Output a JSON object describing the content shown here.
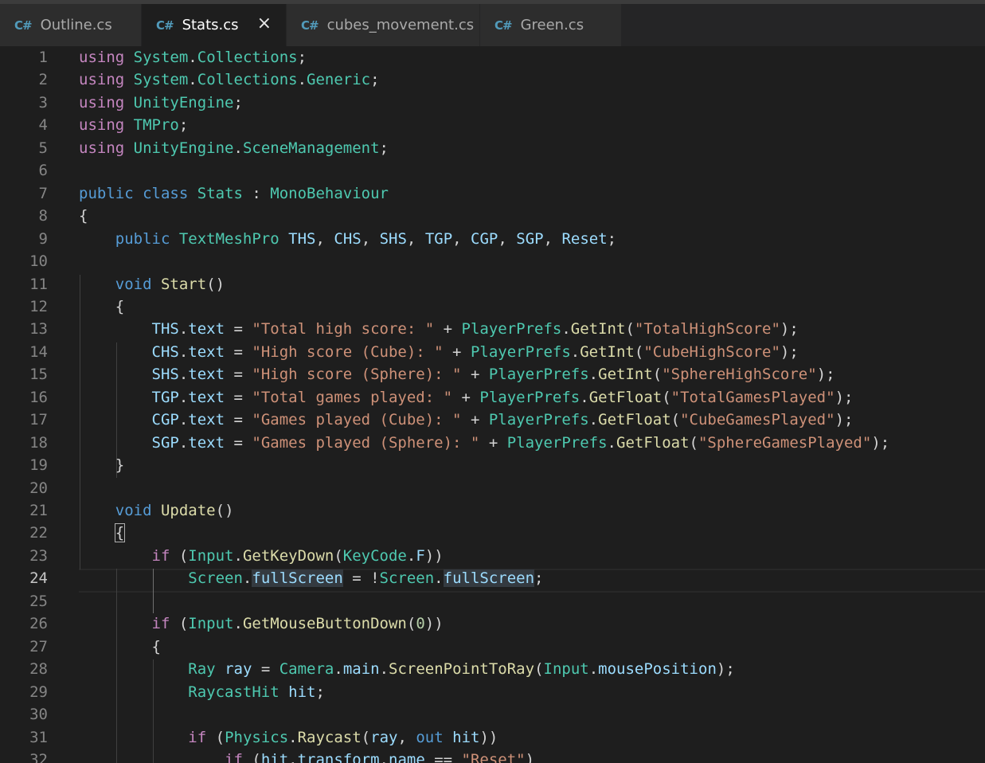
{
  "tabs": [
    {
      "icon": "C#",
      "label": "Outline.cs",
      "active": false
    },
    {
      "icon": "C#",
      "label": "Stats.cs",
      "active": true,
      "close": "×"
    },
    {
      "icon": "C#",
      "label": "cubes_movement.cs",
      "active": false
    },
    {
      "icon": "C#",
      "label": "Green.cs",
      "active": false
    }
  ],
  "editor": {
    "current_line": 24,
    "lines": [
      {
        "n": "1",
        "tokens": [
          [
            "kw2",
            "using"
          ],
          [
            "",
            " "
          ],
          [
            "ty",
            "System"
          ],
          [
            "",
            "."
          ],
          [
            "ty",
            "Collections"
          ],
          [
            "",
            ";"
          ]
        ]
      },
      {
        "n": "2",
        "tokens": [
          [
            "kw2",
            "using"
          ],
          [
            "",
            " "
          ],
          [
            "ty",
            "System"
          ],
          [
            "",
            "."
          ],
          [
            "ty",
            "Collections"
          ],
          [
            "",
            "."
          ],
          [
            "ty",
            "Generic"
          ],
          [
            "",
            ";"
          ]
        ]
      },
      {
        "n": "3",
        "tokens": [
          [
            "kw2",
            "using"
          ],
          [
            "",
            " "
          ],
          [
            "ty",
            "UnityEngine"
          ],
          [
            "",
            ";"
          ]
        ]
      },
      {
        "n": "4",
        "tokens": [
          [
            "kw2",
            "using"
          ],
          [
            "",
            " "
          ],
          [
            "ty",
            "TMPro"
          ],
          [
            "",
            ";"
          ]
        ]
      },
      {
        "n": "5",
        "tokens": [
          [
            "kw2",
            "using"
          ],
          [
            "",
            " "
          ],
          [
            "ty",
            "UnityEngine"
          ],
          [
            "",
            "."
          ],
          [
            "ty",
            "SceneManagement"
          ],
          [
            "",
            ";"
          ]
        ]
      },
      {
        "n": "6",
        "tokens": []
      },
      {
        "n": "7",
        "tokens": [
          [
            "kw",
            "public"
          ],
          [
            "",
            " "
          ],
          [
            "kw",
            "class"
          ],
          [
            "",
            " "
          ],
          [
            "ty",
            "Stats"
          ],
          [
            "",
            " : "
          ],
          [
            "ty",
            "MonoBehaviour"
          ]
        ]
      },
      {
        "n": "8",
        "tokens": [
          [
            "",
            "{"
          ]
        ]
      },
      {
        "n": "9",
        "tokens": [
          [
            "",
            "    "
          ],
          [
            "kw",
            "public"
          ],
          [
            "",
            " "
          ],
          [
            "ty",
            "TextMeshPro"
          ],
          [
            "",
            " "
          ],
          [
            "var",
            "THS"
          ],
          [
            "",
            ", "
          ],
          [
            "var",
            "CHS"
          ],
          [
            "",
            ", "
          ],
          [
            "var",
            "SHS"
          ],
          [
            "",
            ", "
          ],
          [
            "var",
            "TGP"
          ],
          [
            "",
            ", "
          ],
          [
            "var",
            "CGP"
          ],
          [
            "",
            ", "
          ],
          [
            "var",
            "SGP"
          ],
          [
            "",
            ", "
          ],
          [
            "var",
            "Reset"
          ],
          [
            "",
            ";"
          ]
        ]
      },
      {
        "n": "10",
        "tokens": []
      },
      {
        "n": "11",
        "tokens": [
          [
            "",
            "    "
          ],
          [
            "kw",
            "void"
          ],
          [
            "",
            " "
          ],
          [
            "fn",
            "Start"
          ],
          [
            "",
            "()"
          ]
        ]
      },
      {
        "n": "12",
        "tokens": [
          [
            "",
            "    {"
          ]
        ]
      },
      {
        "n": "13",
        "tokens": [
          [
            "",
            "        "
          ],
          [
            "var",
            "THS"
          ],
          [
            "",
            "."
          ],
          [
            "var",
            "text"
          ],
          [
            "",
            " = "
          ],
          [
            "str",
            "\"Total high score: \""
          ],
          [
            "",
            " + "
          ],
          [
            "ty",
            "PlayerPrefs"
          ],
          [
            "",
            "."
          ],
          [
            "fn",
            "GetInt"
          ],
          [
            "",
            "("
          ],
          [
            "str",
            "\"TotalHighScore\""
          ],
          [
            "",
            ");"
          ]
        ]
      },
      {
        "n": "14",
        "tokens": [
          [
            "",
            "        "
          ],
          [
            "var",
            "CHS"
          ],
          [
            "",
            "."
          ],
          [
            "var",
            "text"
          ],
          [
            "",
            " = "
          ],
          [
            "str",
            "\"High score (Cube): \""
          ],
          [
            "",
            " + "
          ],
          [
            "ty",
            "PlayerPrefs"
          ],
          [
            "",
            "."
          ],
          [
            "fn",
            "GetInt"
          ],
          [
            "",
            "("
          ],
          [
            "str",
            "\"CubeHighScore\""
          ],
          [
            "",
            ");"
          ]
        ]
      },
      {
        "n": "15",
        "tokens": [
          [
            "",
            "        "
          ],
          [
            "var",
            "SHS"
          ],
          [
            "",
            "."
          ],
          [
            "var",
            "text"
          ],
          [
            "",
            " = "
          ],
          [
            "str",
            "\"High score (Sphere): \""
          ],
          [
            "",
            " + "
          ],
          [
            "ty",
            "PlayerPrefs"
          ],
          [
            "",
            "."
          ],
          [
            "fn",
            "GetInt"
          ],
          [
            "",
            "("
          ],
          [
            "str",
            "\"SphereHighScore\""
          ],
          [
            "",
            ");"
          ]
        ]
      },
      {
        "n": "16",
        "tokens": [
          [
            "",
            "        "
          ],
          [
            "var",
            "TGP"
          ],
          [
            "",
            "."
          ],
          [
            "var",
            "text"
          ],
          [
            "",
            " = "
          ],
          [
            "str",
            "\"Total games played: \""
          ],
          [
            "",
            " + "
          ],
          [
            "ty",
            "PlayerPrefs"
          ],
          [
            "",
            "."
          ],
          [
            "fn",
            "GetFloat"
          ],
          [
            "",
            "("
          ],
          [
            "str",
            "\"TotalGamesPlayed\""
          ],
          [
            "",
            ");"
          ]
        ]
      },
      {
        "n": "17",
        "tokens": [
          [
            "",
            "        "
          ],
          [
            "var",
            "CGP"
          ],
          [
            "",
            "."
          ],
          [
            "var",
            "text"
          ],
          [
            "",
            " = "
          ],
          [
            "str",
            "\"Games played (Cube): \""
          ],
          [
            "",
            " + "
          ],
          [
            "ty",
            "PlayerPrefs"
          ],
          [
            "",
            "."
          ],
          [
            "fn",
            "GetFloat"
          ],
          [
            "",
            "("
          ],
          [
            "str",
            "\"CubeGamesPlayed\""
          ],
          [
            "",
            ");"
          ]
        ]
      },
      {
        "n": "18",
        "tokens": [
          [
            "",
            "        "
          ],
          [
            "var",
            "SGP"
          ],
          [
            "",
            "."
          ],
          [
            "var",
            "text"
          ],
          [
            "",
            " = "
          ],
          [
            "str",
            "\"Games played (Sphere): \""
          ],
          [
            "",
            " + "
          ],
          [
            "ty",
            "PlayerPrefs"
          ],
          [
            "",
            "."
          ],
          [
            "fn",
            "GetFloat"
          ],
          [
            "",
            "("
          ],
          [
            "str",
            "\"SphereGamesPlayed\""
          ],
          [
            "",
            ");"
          ]
        ]
      },
      {
        "n": "19",
        "tokens": [
          [
            "",
            "    }"
          ]
        ]
      },
      {
        "n": "20",
        "tokens": []
      },
      {
        "n": "21",
        "tokens": [
          [
            "",
            "    "
          ],
          [
            "kw",
            "void"
          ],
          [
            "",
            " "
          ],
          [
            "fn",
            "Update"
          ],
          [
            "",
            "()"
          ]
        ]
      },
      {
        "n": "22",
        "tokens": [
          [
            "",
            "    "
          ],
          [
            "brk",
            "{"
          ]
        ]
      },
      {
        "n": "23",
        "tokens": [
          [
            "",
            "        "
          ],
          [
            "kw2",
            "if"
          ],
          [
            "",
            " ("
          ],
          [
            "ty",
            "Input"
          ],
          [
            "",
            "."
          ],
          [
            "fn",
            "GetKeyDown"
          ],
          [
            "",
            "("
          ],
          [
            "ty",
            "KeyCode"
          ],
          [
            "",
            "."
          ],
          [
            "var",
            "F"
          ],
          [
            "",
            "))"
          ]
        ]
      },
      {
        "n": "24",
        "tokens": [
          [
            "",
            "            "
          ],
          [
            "ty",
            "Screen"
          ],
          [
            "",
            "."
          ],
          [
            "var hl",
            "fullScreen"
          ],
          [
            "",
            " = !"
          ],
          [
            "ty",
            "Screen"
          ],
          [
            "",
            "."
          ],
          [
            "var hl",
            "fullScreen"
          ],
          [
            "",
            ";"
          ]
        ]
      },
      {
        "n": "25",
        "tokens": []
      },
      {
        "n": "26",
        "tokens": [
          [
            "",
            "        "
          ],
          [
            "kw2",
            "if"
          ],
          [
            "",
            " ("
          ],
          [
            "ty",
            "Input"
          ],
          [
            "",
            "."
          ],
          [
            "fn",
            "GetMouseButtonDown"
          ],
          [
            "",
            "("
          ],
          [
            "num",
            "0"
          ],
          [
            "",
            "))"
          ]
        ]
      },
      {
        "n": "27",
        "tokens": [
          [
            "",
            "        {"
          ]
        ]
      },
      {
        "n": "28",
        "tokens": [
          [
            "",
            "            "
          ],
          [
            "ty",
            "Ray"
          ],
          [
            "",
            " "
          ],
          [
            "var",
            "ray"
          ],
          [
            "",
            " = "
          ],
          [
            "ty",
            "Camera"
          ],
          [
            "",
            "."
          ],
          [
            "var",
            "main"
          ],
          [
            "",
            "."
          ],
          [
            "fn",
            "ScreenPointToRay"
          ],
          [
            "",
            "("
          ],
          [
            "ty",
            "Input"
          ],
          [
            "",
            "."
          ],
          [
            "var",
            "mousePosition"
          ],
          [
            "",
            ");"
          ]
        ]
      },
      {
        "n": "29",
        "tokens": [
          [
            "",
            "            "
          ],
          [
            "ty",
            "RaycastHit"
          ],
          [
            "",
            " "
          ],
          [
            "var",
            "hit"
          ],
          [
            "",
            ";"
          ]
        ]
      },
      {
        "n": "30",
        "tokens": []
      },
      {
        "n": "31",
        "tokens": [
          [
            "",
            "            "
          ],
          [
            "kw2",
            "if"
          ],
          [
            "",
            " ("
          ],
          [
            "ty",
            "Physics"
          ],
          [
            "",
            "."
          ],
          [
            "fn",
            "Raycast"
          ],
          [
            "",
            "("
          ],
          [
            "var",
            "ray"
          ],
          [
            "",
            ", "
          ],
          [
            "kw",
            "out"
          ],
          [
            "",
            " "
          ],
          [
            "var",
            "hit"
          ],
          [
            "",
            "))"
          ]
        ]
      },
      {
        "n": "32",
        "tokens": [
          [
            "",
            "                "
          ],
          [
            "kw2",
            "if"
          ],
          [
            "",
            " ("
          ],
          [
            "var",
            "hit"
          ],
          [
            "",
            "."
          ],
          [
            "var",
            "transform"
          ],
          [
            "",
            "."
          ],
          [
            "var",
            "name"
          ],
          [
            "",
            " == "
          ],
          [
            "str",
            "\"Reset\""
          ],
          [
            "",
            ")"
          ]
        ]
      }
    ]
  }
}
